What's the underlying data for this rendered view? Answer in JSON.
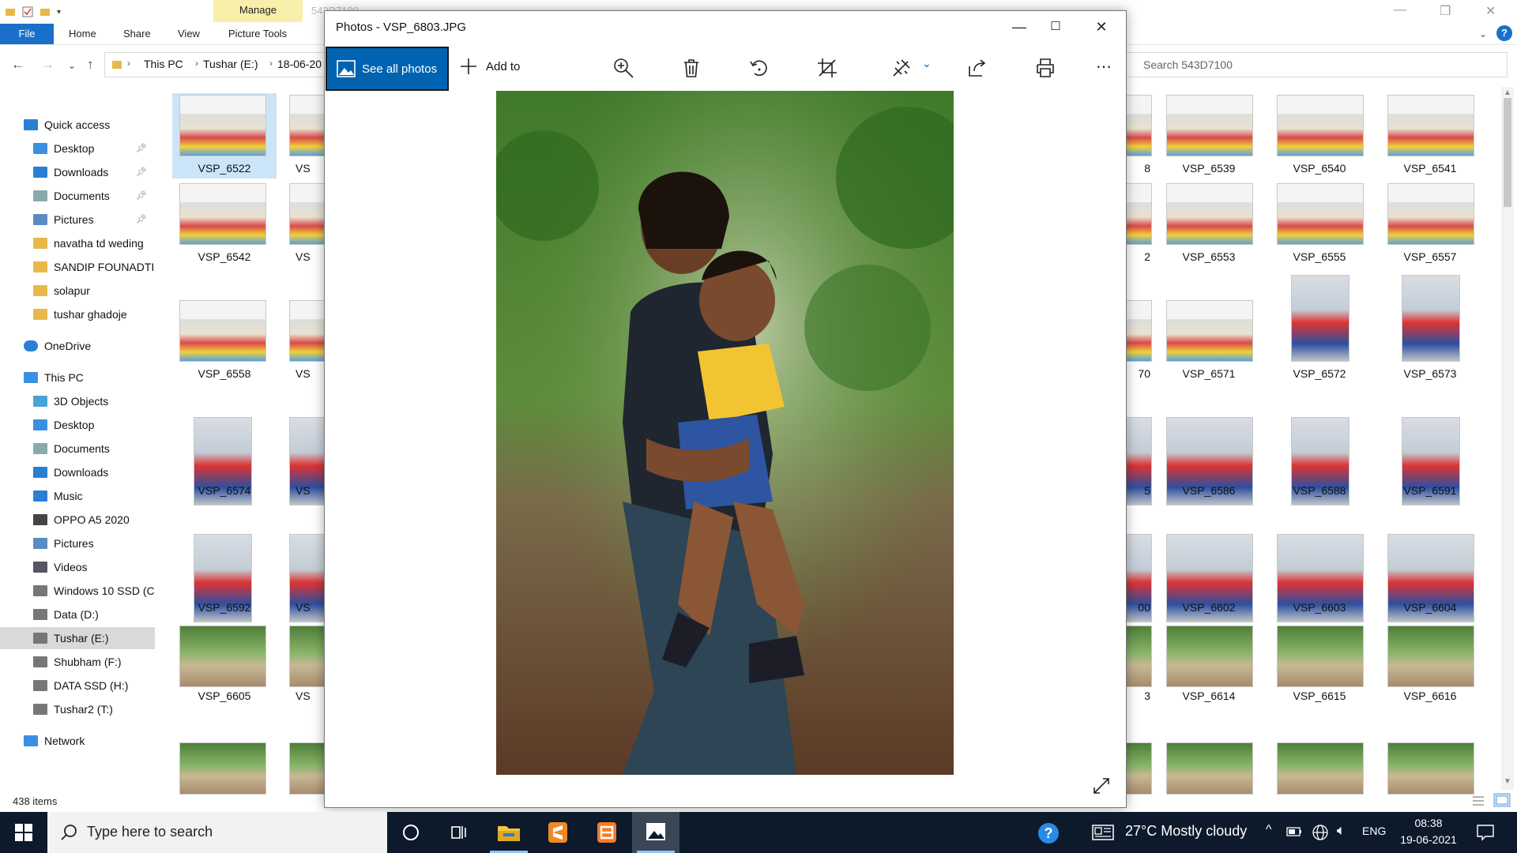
{
  "explorer": {
    "manage_tab": "Manage",
    "folder_title": "543D7100",
    "ribbon": {
      "file": "File",
      "tabs": [
        "Home",
        "Share",
        "View",
        "Picture Tools"
      ]
    },
    "address": {
      "crumbs": [
        "This PC",
        "Tushar (E:)",
        "18-06-20"
      ]
    },
    "search_placeholder": "Search 543D7100",
    "sidebar": [
      {
        "label": "Quick access",
        "icon": "star-icon",
        "level": 0
      },
      {
        "label": "Desktop",
        "icon": "desktop-icon",
        "level": 1,
        "pinned": true
      },
      {
        "label": "Downloads",
        "icon": "download-icon",
        "level": 1,
        "pinned": true
      },
      {
        "label": "Documents",
        "icon": "documents-icon",
        "level": 1,
        "pinned": true
      },
      {
        "label": "Pictures",
        "icon": "pictures-icon",
        "level": 1,
        "pinned": true
      },
      {
        "label": "navatha td weding",
        "icon": "folder-icon",
        "level": 1
      },
      {
        "label": "SANDIP FOUNADTI(",
        "icon": "folder-icon",
        "level": 1
      },
      {
        "label": "solapur",
        "icon": "folder-icon",
        "level": 1
      },
      {
        "label": "tushar ghadoje",
        "icon": "folder-icon",
        "level": 1
      },
      {
        "label": "OneDrive",
        "icon": "cloud-icon",
        "level": 0
      },
      {
        "label": "This PC",
        "icon": "pc-icon",
        "level": 0
      },
      {
        "label": "3D Objects",
        "icon": "cube-icon",
        "level": 1
      },
      {
        "label": "Desktop",
        "icon": "desktop-icon",
        "level": 1
      },
      {
        "label": "Documents",
        "icon": "documents-icon",
        "level": 1
      },
      {
        "label": "Downloads",
        "icon": "download-icon",
        "level": 1
      },
      {
        "label": "Music",
        "icon": "music-icon",
        "level": 1
      },
      {
        "label": "OPPO A5 2020",
        "icon": "phone-icon",
        "level": 1
      },
      {
        "label": "Pictures",
        "icon": "pictures-icon",
        "level": 1
      },
      {
        "label": "Videos",
        "icon": "videos-icon",
        "level": 1
      },
      {
        "label": "Windows 10 SSD (C",
        "icon": "drive-icon",
        "level": 1
      },
      {
        "label": "Data (D:)",
        "icon": "drive-icon",
        "level": 1
      },
      {
        "label": "Tushar (E:)",
        "icon": "drive-icon",
        "level": 1,
        "selected": true
      },
      {
        "label": "Shubham (F:)",
        "icon": "drive-icon",
        "level": 1
      },
      {
        "label": "DATA SSD (H:)",
        "icon": "drive-icon",
        "level": 1
      },
      {
        "label": "Tushar2 (T:)",
        "icon": "drive-icon",
        "level": 1
      },
      {
        "label": "Network",
        "icon": "network-icon",
        "level": 0
      }
    ],
    "left_col1": [
      "VSP_6522",
      "VSP_6542",
      "VSP_6558",
      "VSP_6574",
      "VSP_6592",
      "VSP_6605",
      ""
    ],
    "left_col2": [
      "VS",
      "VS",
      "VS",
      "VS",
      "VS",
      "VS",
      ""
    ],
    "right_partial": [
      "8",
      "2",
      "70",
      "5",
      "00",
      "3",
      ""
    ],
    "right_grid": [
      [
        "VSP_6539",
        "VSP_6540",
        "VSP_6541"
      ],
      [
        "VSP_6553",
        "VSP_6555",
        "VSP_6557"
      ],
      [
        "VSP_6571",
        "VSP_6572",
        "VSP_6573"
      ],
      [
        "VSP_6586",
        "VSP_6588",
        "VSP_6591"
      ],
      [
        "VSP_6602",
        "VSP_6603",
        "VSP_6604"
      ],
      [
        "VSP_6614",
        "VSP_6615",
        "VSP_6616"
      ],
      [
        "",
        "",
        ""
      ]
    ],
    "status": "438 items"
  },
  "photos": {
    "title": "Photos - VSP_6803.JPG",
    "see_all": "See all photos",
    "add_to": "Add to",
    "toolbar_icons": [
      "zoom-in-icon",
      "delete-icon",
      "rotate-icon",
      "crop-icon",
      "edit-icon",
      "share-icon",
      "print-icon",
      "more-icon"
    ]
  },
  "taskbar": {
    "search_placeholder": "Type here to search",
    "weather": "27°C  Mostly cloudy",
    "lang": "ENG",
    "time": "08:38",
    "date": "19-06-2021"
  },
  "colors": {
    "accent": "#0063b1",
    "taskbar": "#0d1a2b",
    "manage_tab": "#f7efaa"
  }
}
